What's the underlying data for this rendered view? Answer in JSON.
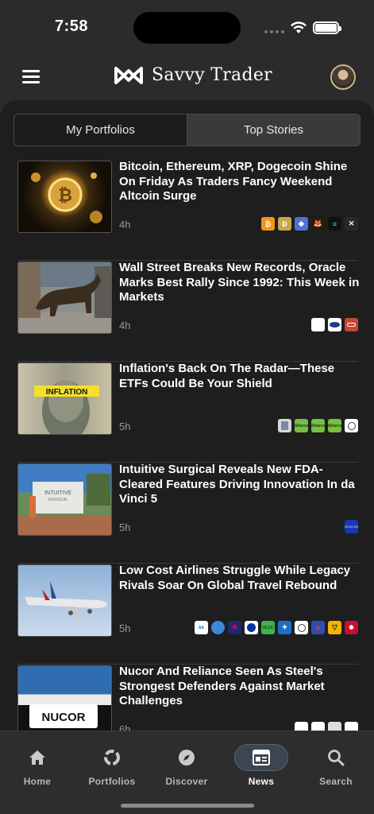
{
  "status": {
    "time": "7:58"
  },
  "app": {
    "name": "Savvy Trader"
  },
  "tabs": {
    "portfolios": "My Portfolios",
    "stories": "Top Stories",
    "active": "Top Stories"
  },
  "stories": [
    {
      "title": "Bitcoin, Ethereum, XRP, Dogecoin Shine On Friday As Traders Fancy Weekend Altcoin Surge",
      "age": "4h",
      "tickers": [
        "bitcoin-logo",
        "dogecoin-logo",
        "ethereum-logo",
        "shiba-logo",
        "solana-logo",
        "xrp-logo"
      ]
    },
    {
      "title": "Wall Street Breaks New Records, Oracle Marks Best Rally Since 1992: This Week in Markets",
      "age": "4h",
      "tickers": [
        "apple-logo",
        "ford-logo",
        "oracle-logo"
      ]
    },
    {
      "title": "Inflation's Back On The Radar—These ETFs Could Be Your Shield",
      "age": "5h",
      "tickers": [
        "etf-logo",
        "ishares-logo",
        "ishares-logo",
        "ishares-logo",
        "circle-logo"
      ]
    },
    {
      "title": "Intuitive Surgical Reveals New FDA-Cleared Features Driving Innovation In da Vinci 5",
      "age": "5h",
      "tickers": [
        "intuitive-logo"
      ]
    },
    {
      "title": "Low Cost Airlines Struggle While Legacy Rivals Soar On Global Travel Rebound",
      "age": "5h",
      "tickers": [
        "american-logo",
        "alaska-logo",
        "united-logo",
        "jetblue-logo",
        "frontier-logo",
        "spirit-logo",
        "circle-logo",
        "southwest-logo",
        "allegiant-logo",
        "delta-logo"
      ]
    },
    {
      "title": "Nucor And Reliance Seen As Steel's Strongest Defenders Against Market Challenges",
      "age": "6h",
      "tickers": [
        "nucor-logo",
        "reliance-logo",
        "steel-logo",
        "cleveland-logo"
      ]
    }
  ],
  "nav": [
    {
      "label": "Home",
      "icon": "home-icon"
    },
    {
      "label": "Portfolios",
      "icon": "portfolios-icon"
    },
    {
      "label": "Discover",
      "icon": "compass-icon"
    },
    {
      "label": "News",
      "icon": "news-icon"
    },
    {
      "label": "Search",
      "icon": "search-icon"
    }
  ],
  "colors": {
    "background": "#1e1e1f",
    "active_tab": "#3d4650",
    "accent_orange": "#f7931a"
  }
}
